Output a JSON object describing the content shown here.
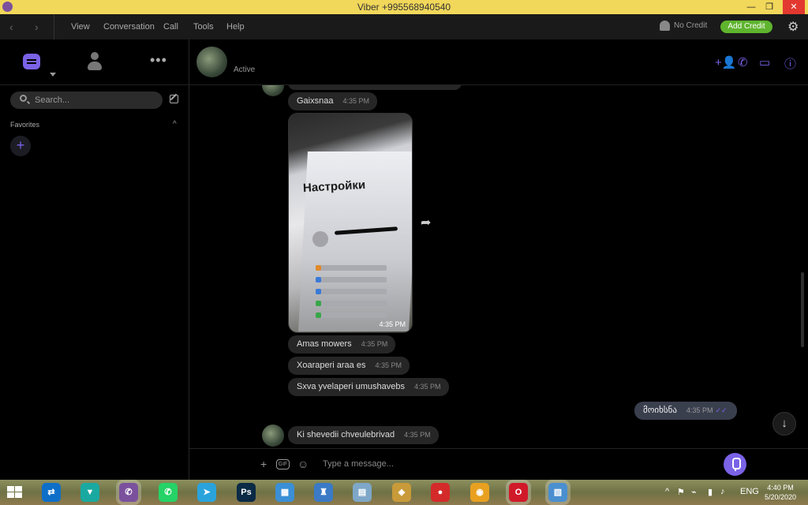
{
  "window": {
    "title": "Viber +995568940540",
    "minimize_glyph": "—",
    "restore_glyph": "❐",
    "close_glyph": "✕"
  },
  "menu": {
    "back_glyph": "‹",
    "forward_glyph": "›",
    "items": [
      "View",
      "Conversation",
      "Call",
      "Tools",
      "Help"
    ],
    "no_credit": "No Credit",
    "add_credit": "Add Credit",
    "gear_glyph": "⚙"
  },
  "sidebar": {
    "more_glyph": "•••",
    "search_placeholder": "Search...",
    "favorites_label": "Favorites",
    "favorites_chevron": "^",
    "add_glyph": "+"
  },
  "chat": {
    "status": "Active",
    "header_icons": [
      "add-participant-icon",
      "call-icon",
      "video-call-icon",
      "info-icon"
    ],
    "header_glyphs": [
      "+👤",
      "✆",
      "▭",
      "ⓘ"
    ],
    "messages": [
      {
        "text": "Gaixsnaa",
        "time": "4:35 PM"
      },
      {
        "text": "Amas mowers",
        "time": "4:35 PM"
      },
      {
        "text": "Xoaraperi araa es",
        "time": "4:35 PM"
      },
      {
        "text": "Sxva yvelaperi umushavebs",
        "time": "4:35 PM"
      },
      {
        "text": "მოიხსნა",
        "time": "4:35 PM",
        "ticks": "✓✓"
      },
      {
        "text": "Ki shevedii chveulebrivad",
        "time": "4:35 PM"
      }
    ],
    "photo": {
      "screen_title": "Настройки",
      "time": "4:35 PM"
    },
    "share_glyph": "➦",
    "scroll_down_glyph": "↓",
    "composer_placeholder": "Type a message...",
    "composer_plus_glyph": "+",
    "gif_label": "GIF",
    "sticker_glyph": "☺"
  },
  "taskbar": {
    "apps": [
      {
        "name": "teamviewer",
        "label": "⇄",
        "color": "#0e6fc9"
      },
      {
        "name": "vpn",
        "label": "▼",
        "color": "#1aa9a0"
      },
      {
        "name": "viber",
        "label": "✆",
        "color": "#7b519d",
        "active": true
      },
      {
        "name": "whatsapp",
        "label": "✆",
        "color": "#25d366"
      },
      {
        "name": "telegram",
        "label": "➤",
        "color": "#2aa3dc"
      },
      {
        "name": "photoshop",
        "label": "Ps",
        "color": "#0a2a45"
      },
      {
        "name": "control-panel",
        "label": "▦",
        "color": "#3a8fd6"
      },
      {
        "name": "security",
        "label": "♜",
        "color": "#3a7ac6"
      },
      {
        "name": "calculator",
        "label": "▤",
        "color": "#7ea7c8"
      },
      {
        "name": "installer",
        "label": "◈",
        "color": "#c99a3a"
      },
      {
        "name": "recorder",
        "label": "●",
        "color": "#d42a2a"
      },
      {
        "name": "chrome",
        "label": "◉",
        "color": "#e8a020"
      },
      {
        "name": "opera",
        "label": "O",
        "color": "#d01a2a",
        "active": true
      },
      {
        "name": "image-viewer",
        "label": "▧",
        "color": "#4a8fd0",
        "active": true
      }
    ],
    "tray": {
      "chevron": "^",
      "lang": "ENG",
      "time": "4:40 PM",
      "date": "5/20/2020"
    }
  }
}
